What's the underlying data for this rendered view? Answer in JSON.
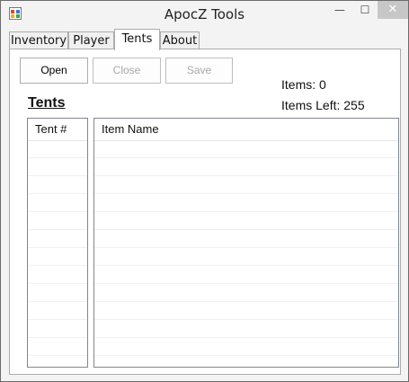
{
  "window": {
    "title": "ApocZ Tools",
    "min_glyph": "—",
    "max_glyph": "☐",
    "close_glyph": "✕"
  },
  "tabs": [
    {
      "label": "Inventory"
    },
    {
      "label": "Player"
    },
    {
      "label": "Tents",
      "active": true
    },
    {
      "label": "About"
    }
  ],
  "toolbar": {
    "open_label": "Open",
    "close_label": "Close",
    "save_label": "Save"
  },
  "stats": {
    "items": "Items: 0",
    "items_left": "Items Left: 255"
  },
  "tents": {
    "heading": "Tents",
    "tent_list": {
      "header": "Tent #",
      "rows": []
    },
    "item_list": {
      "header": "Item Name",
      "rows": []
    }
  }
}
